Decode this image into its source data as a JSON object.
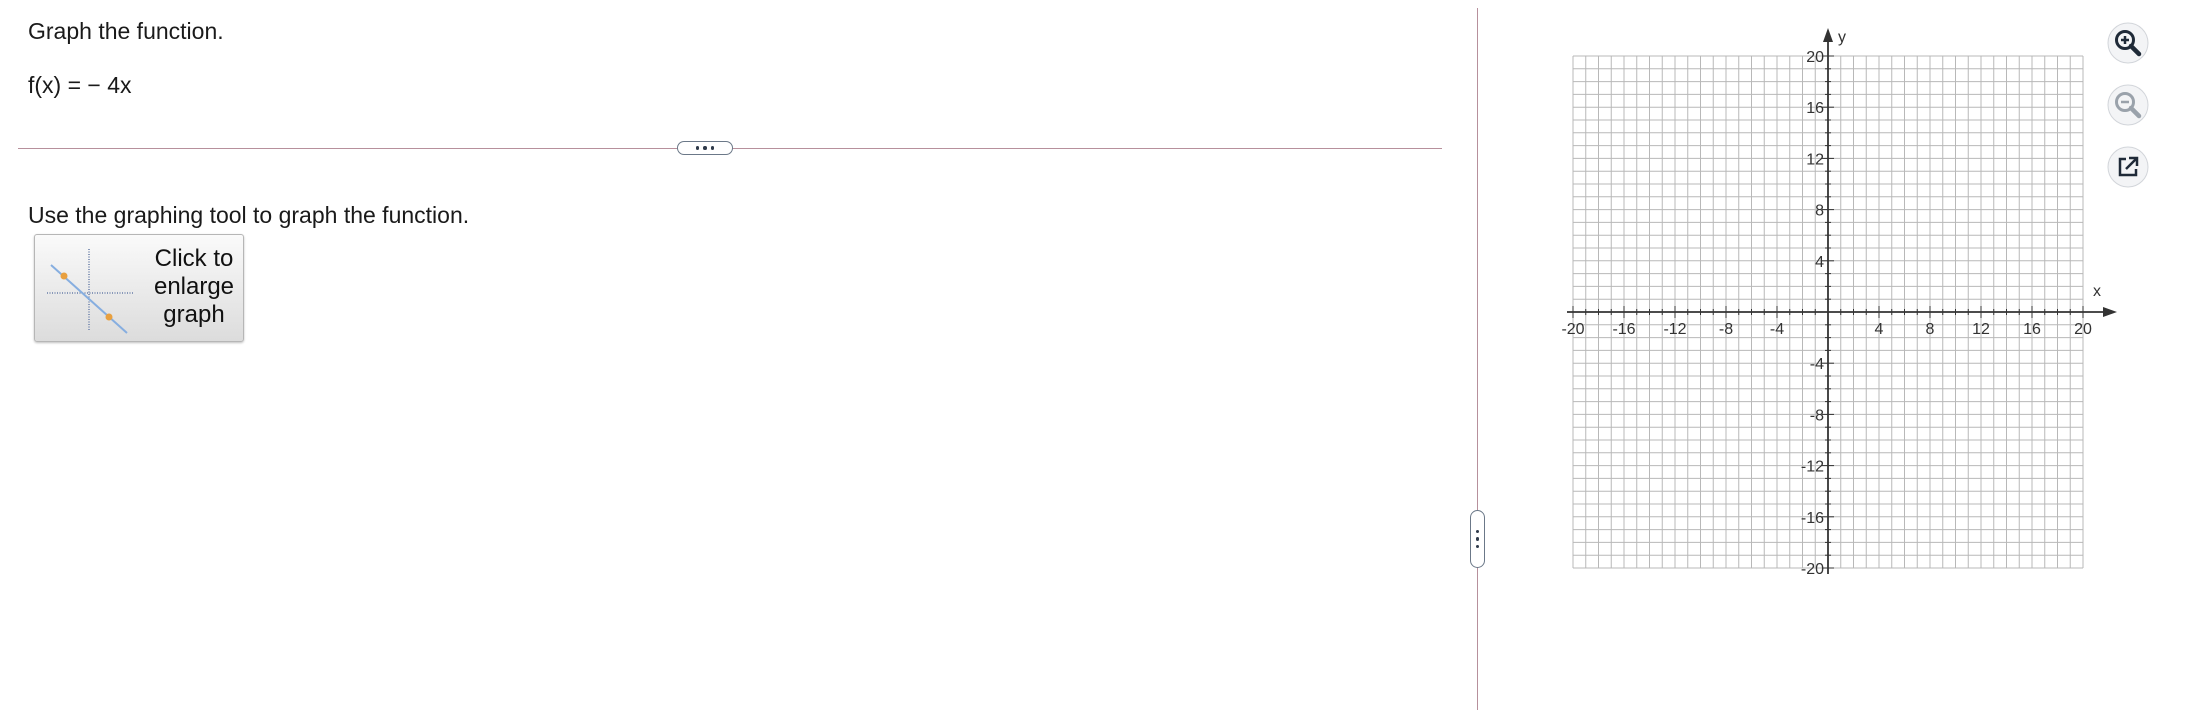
{
  "question": {
    "prompt": "Graph the function.",
    "function_text": "f(x) = − 4x",
    "instruction": "Use the graphing tool to graph the function.",
    "enlarge_label": "Click to\nenlarge\ngraph"
  },
  "graph": {
    "x_label": "x",
    "y_label": "y",
    "xlim": [
      -20,
      20
    ],
    "ylim": [
      -20,
      20
    ],
    "minor_step": 1,
    "tick_step": 4,
    "x_ticks": [
      "-20",
      "-16",
      "-12",
      "-8",
      "-4",
      "4",
      "8",
      "12",
      "16",
      "20"
    ],
    "y_ticks": [
      "20",
      "16",
      "12",
      "8",
      "4",
      "-4",
      "-8",
      "-12",
      "-16",
      "-20"
    ]
  },
  "tools": {
    "zoom_in": "zoom-in-icon",
    "zoom_out": "zoom-out-icon",
    "popout": "popout-icon"
  },
  "colors": {
    "divider": "#b7909c",
    "grid": "#b8b8b8",
    "zoom_in_active": "#1f2a38",
    "zoom_out_inactive": "#9aa2ab"
  }
}
